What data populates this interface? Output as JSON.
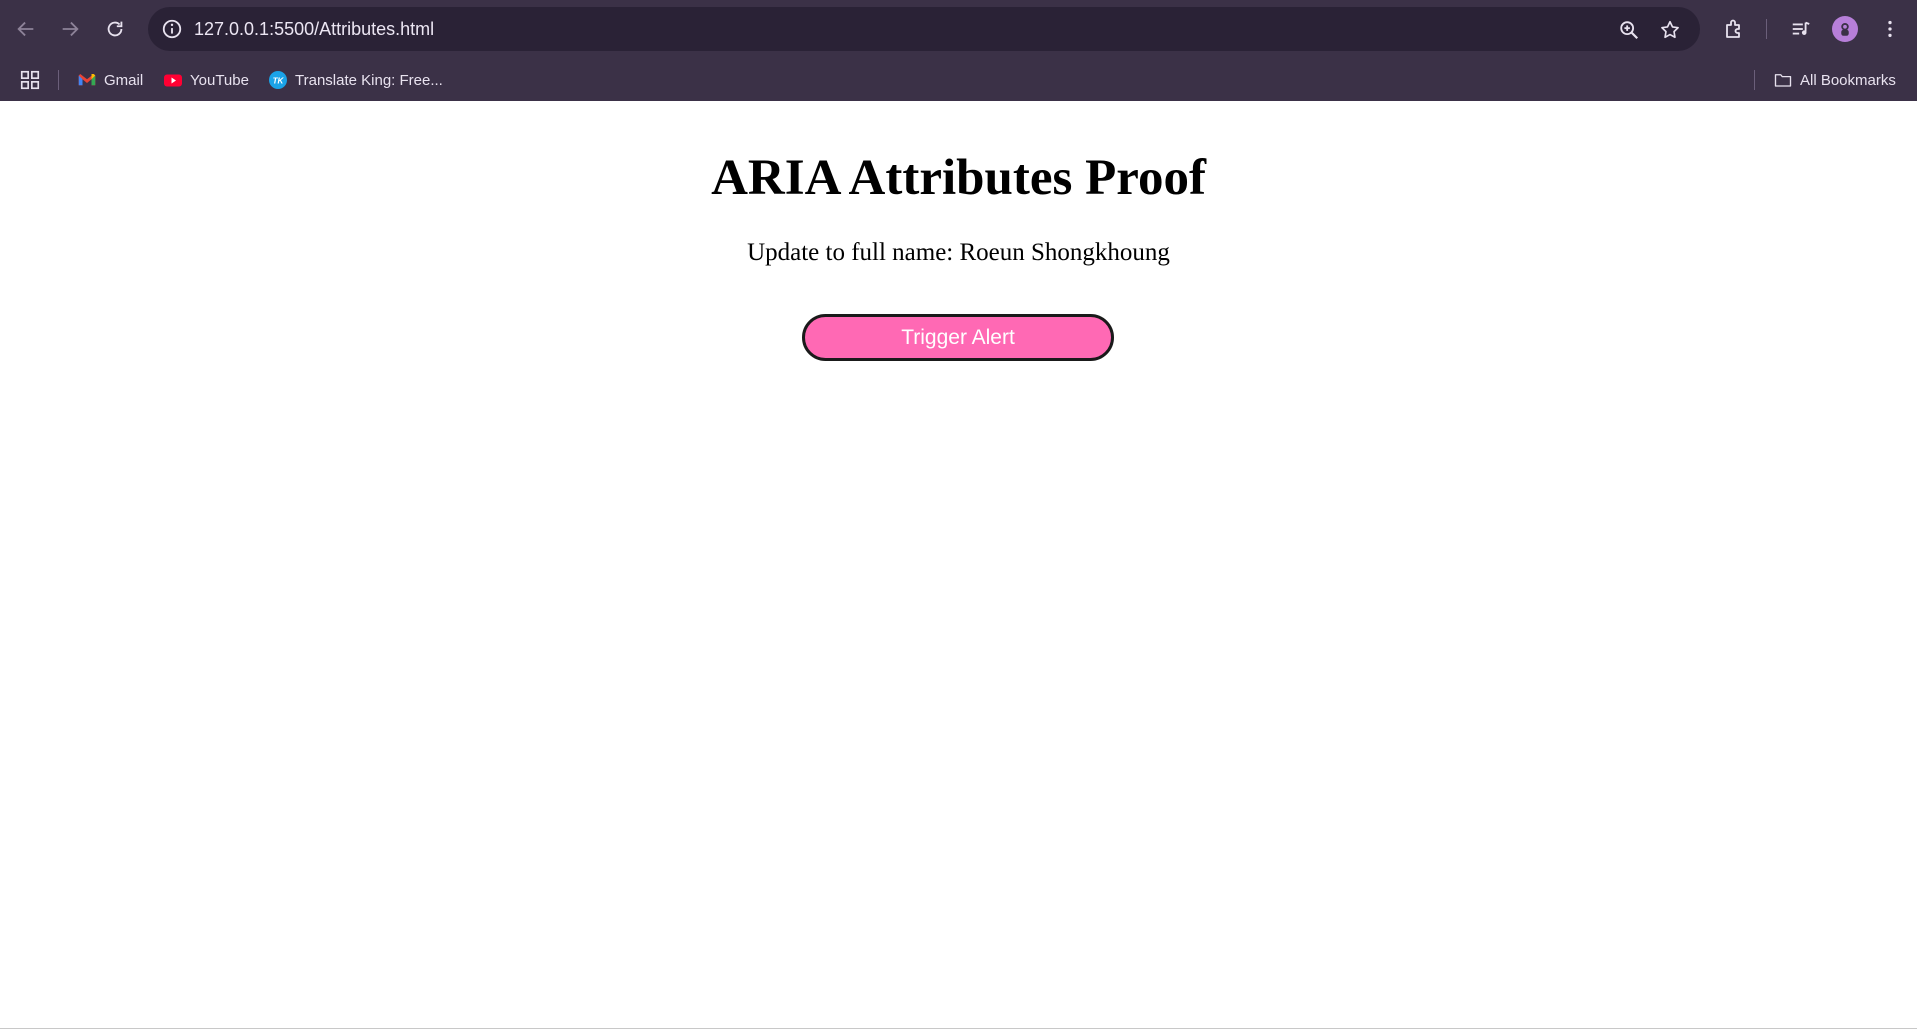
{
  "browser": {
    "url": "127.0.0.1:5500/Attributes.html",
    "bookmarks": [
      {
        "label": "Gmail",
        "icon": "gmail-icon"
      },
      {
        "label": "YouTube",
        "icon": "youtube-icon"
      },
      {
        "label": "Translate King: Free...",
        "icon": "translate-king-icon"
      }
    ],
    "all_bookmarks_label": "All Bookmarks",
    "avatar_color": "#b77fd9"
  },
  "page": {
    "title": "ARIA Attributes Proof",
    "subtitle": "Update to full name: Roeun Shongkhoung",
    "button_label": "Trigger Alert",
    "button_color": "#ff69b4"
  }
}
